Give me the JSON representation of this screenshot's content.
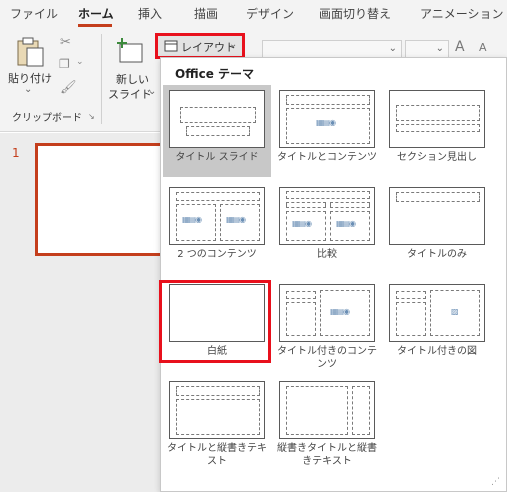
{
  "tabs": [
    "ファイル",
    "ホーム",
    "挿入",
    "描画",
    "デザイン",
    "画面切り替え",
    "アニメーション"
  ],
  "ribbon": {
    "paste_label": "貼り付け",
    "clipboard_group": "クリップボード",
    "new_slide_line1": "新しい",
    "new_slide_line2": "スライド",
    "layout_button": "レイアウト",
    "font_grow": "A",
    "font_shrink": "A"
  },
  "slides": {
    "number": "1"
  },
  "layout_menu": {
    "title": "Office テーマ",
    "items": [
      {
        "name": "タイトル スライド",
        "selected": true
      },
      {
        "name": "タイトルとコンテンツ"
      },
      {
        "name": "セクション見出し"
      },
      {
        "name": "2 つのコンテンツ"
      },
      {
        "name": "比較"
      },
      {
        "name": "タイトルのみ"
      },
      {
        "name": "白紙"
      },
      {
        "name": "タイトル付きのコンテンツ"
      },
      {
        "name": "タイトル付きの図"
      },
      {
        "name": "タイトルと縦書きテキスト"
      },
      {
        "name": "縦書きタイトルと縦書きテキスト"
      }
    ]
  },
  "colors": {
    "accent": "#c43e1c",
    "highlight": "#e8101c",
    "selected_bg": "#c8c8c8"
  }
}
